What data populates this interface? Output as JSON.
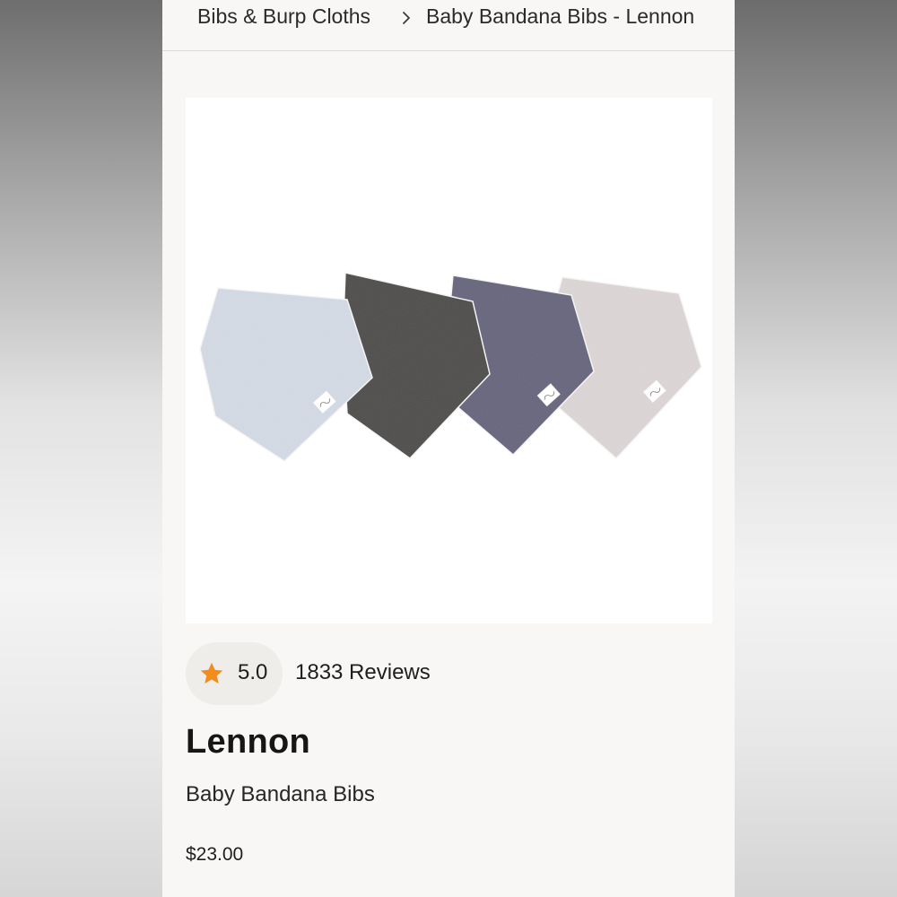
{
  "breadcrumb": {
    "parent_label": "Bibs & Burp Cloths",
    "current_label": "Baby Bandana Bibs - Lennon",
    "separator_icon": "chevron-right-icon"
  },
  "product": {
    "image_alt": "Baby Bandana Bibs - Lennon",
    "bib_colors": [
      "#d4dbe6",
      "#4e4d4b",
      "#66657d",
      "#ddd6d6"
    ],
    "rating": "5.0",
    "rating_icon": "star-icon",
    "rating_icon_color": "#f28c1d",
    "reviews": "1833 Reviews",
    "name": "Lennon",
    "subtitle": "Baby Bandana Bibs",
    "price": "$23.00"
  }
}
